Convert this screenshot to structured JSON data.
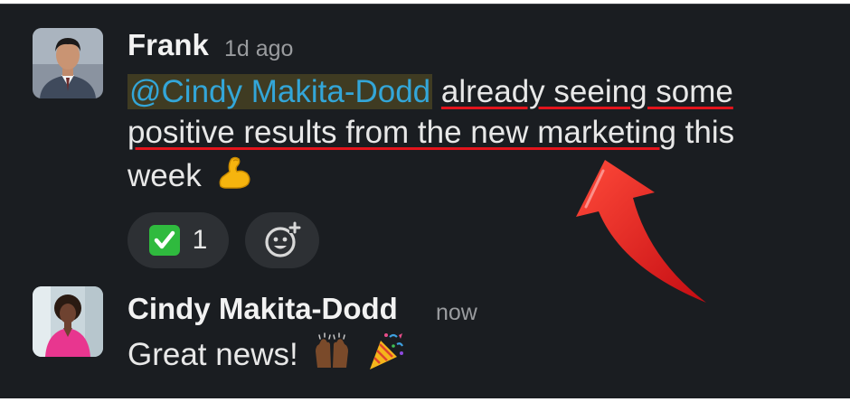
{
  "messages": [
    {
      "author": "Frank",
      "timestamp": "1d ago",
      "lines": {
        "line1": {
          "mention": "@Cindy Makita-Dodd",
          "underlined": "already seeing some"
        },
        "line2": {
          "underlined": "positive results from the new marketing",
          "plain": " this"
        },
        "line3": {
          "plain": "week",
          "emoji": "flexed-biceps"
        }
      },
      "reactions": [
        {
          "emoji": "white-check-mark",
          "count": "1"
        }
      ],
      "add_reaction_icon": "add-emoji-icon"
    },
    {
      "author": "Cindy Makita-Dodd",
      "timestamp": "now",
      "text": "Great news!",
      "emojis": [
        "raising-hands",
        "party-popper"
      ]
    }
  ],
  "colors": {
    "background": "#1a1d21",
    "mention_text": "#33a6d8",
    "mention_bg": "#3f3b22",
    "annotation_red": "#e3141c",
    "reaction_bg": "#2d3034",
    "check_green": "#2fba3e"
  }
}
